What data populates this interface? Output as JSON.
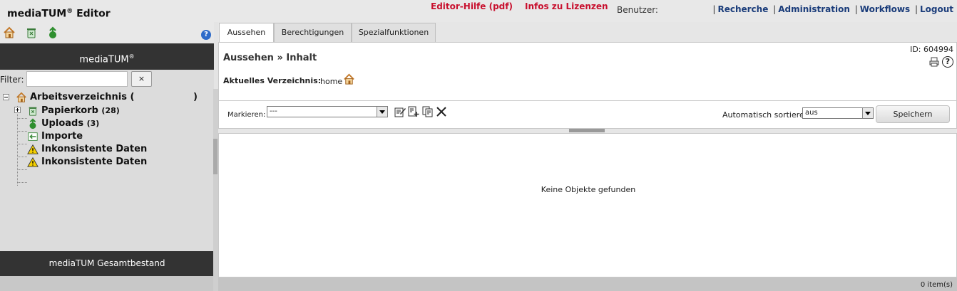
{
  "header": {
    "app_title": "mediaTUM",
    "app_title_reg": "®",
    "app_title_suffix": " Editor",
    "editor_help": "Editor-Hilfe (pdf)",
    "license_info": "Infos zu Lizenzen",
    "user_label": "Benutzer:",
    "nav": [
      {
        "label": "Recherche"
      },
      {
        "label": "Administration"
      },
      {
        "label": "Workflows"
      },
      {
        "label": "Logout"
      }
    ],
    "nav_separator": "|"
  },
  "sidebar": {
    "title": "mediaTUM",
    "title_reg": "®",
    "filter_label": "Filter:",
    "filter_value": "",
    "filter_clear": "×",
    "tree": [
      {
        "label": "Arbeitsverzeichnis (",
        "label_end": ")",
        "count": "",
        "icon": "home-icon"
      },
      {
        "label": "Papierkorb",
        "count": "(28)",
        "icon": "trash-icon"
      },
      {
        "label": "Uploads",
        "count": "(3)",
        "icon": "upload-icon"
      },
      {
        "label": "Importe",
        "count": "",
        "icon": "import-icon"
      },
      {
        "label": "Inkonsistente Daten",
        "count": "",
        "icon": "warning-icon"
      },
      {
        "label": "Inkonsistente Daten",
        "count": "",
        "icon": "warning-icon"
      }
    ],
    "footer": "mediaTUM Gesamtbestand",
    "toolbar_icons": [
      "home-icon",
      "trash-icon",
      "upload-icon",
      "help-icon"
    ]
  },
  "main": {
    "tabs": [
      {
        "label": "Aussehen",
        "active": true
      },
      {
        "label": "Berechtigungen",
        "active": false
      },
      {
        "label": "Spezialfunktionen",
        "active": false
      }
    ],
    "page_title": "Aussehen » Inhalt",
    "object_id": "ID: 604994",
    "current_dir_label": "Aktuelles Verzeichnis:",
    "current_dir_value": "home",
    "mark_label": "Markieren:",
    "mark_value": "---",
    "autosort_label": "Automatisch sortieren:",
    "autosort_value": "aus",
    "save_label": "Speichern",
    "empty_message": "Keine Objekte gefunden",
    "item_count": "0 item(s)"
  },
  "colors": {
    "accent_red": "#c8102e",
    "nav_blue": "#1a3c7a",
    "dark_bar": "#333333",
    "home_orange": "#c47a2a"
  }
}
